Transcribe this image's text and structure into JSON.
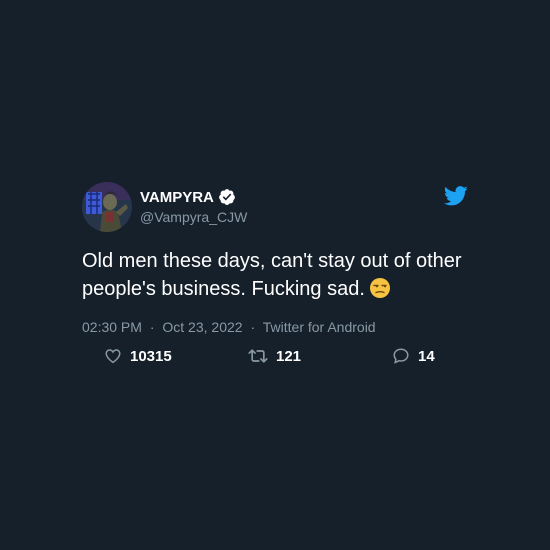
{
  "user": {
    "display_name": "VAMPYRA",
    "handle": "@Vampyra_CJW",
    "verified": true
  },
  "tweet": {
    "text": "Old men these days, can't stay out of other people's business. Fucking sad.",
    "emoji": "unamused-face",
    "time": "02:30 PM",
    "date": "Oct 23, 2022",
    "source": "Twitter for Android",
    "separator": "·"
  },
  "stats": {
    "likes": "10315",
    "retweets": "121",
    "replies": "14"
  },
  "icons": {
    "brand": "twitter-bird-icon",
    "like": "heart-icon",
    "retweet": "retweet-icon",
    "reply": "reply-bubble-icon",
    "verified": "verified-badge-icon"
  },
  "colors": {
    "background": "#15202b",
    "text": "#ffffff",
    "muted": "#8899a6",
    "accent": "#1da1f2"
  }
}
